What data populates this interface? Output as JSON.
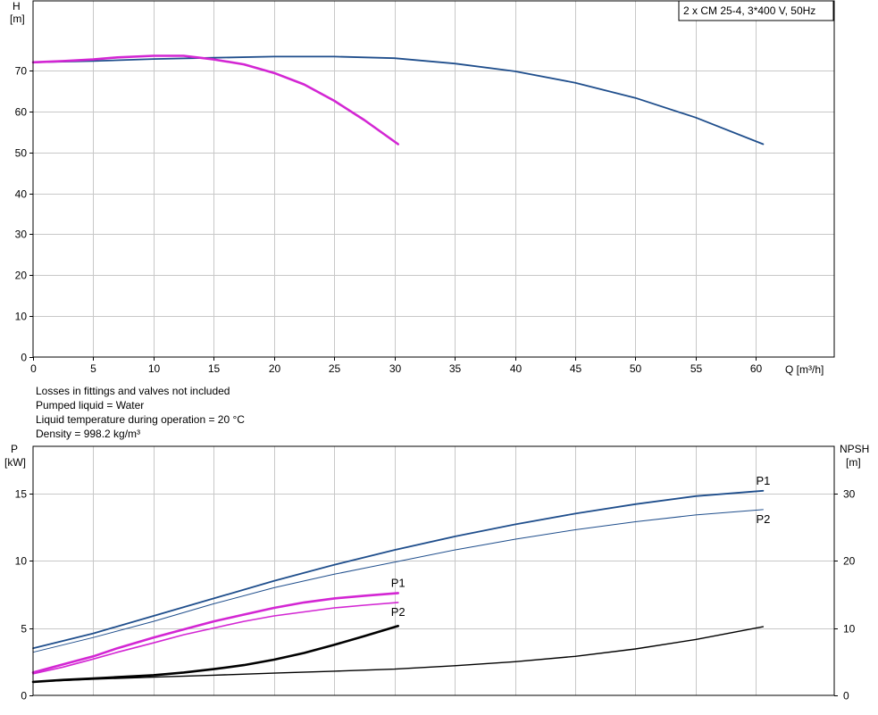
{
  "chart_data": [
    {
      "type": "line",
      "title": "2 x CM 25-4, 3*400 V, 50Hz",
      "ylabel": "H",
      "yunit": "[m]",
      "xlabel": "Q [m³/h]",
      "xlim": [
        0,
        66.5
      ],
      "ylim": [
        0,
        87
      ],
      "xticks": [
        0,
        5,
        10,
        15,
        20,
        25,
        30,
        35,
        40,
        45,
        50,
        55,
        60
      ],
      "yticks": [
        0,
        10,
        20,
        30,
        40,
        50,
        60,
        70
      ],
      "grid": true,
      "series": [
        {
          "color": "#1f4e8c",
          "x": [
            0,
            5,
            10,
            15,
            20,
            25,
            30,
            35,
            40,
            45,
            50,
            55,
            60.6
          ],
          "y": [
            72,
            72.3,
            72.8,
            73.1,
            73.4,
            73.4,
            73.0,
            71.7,
            69.8,
            67.0,
            63.3,
            58.5,
            52.0
          ]
        },
        {
          "color": "#d326d3",
          "x": [
            0,
            2.5,
            5,
            7,
            10,
            12.5,
            15,
            17.5,
            20,
            22.5,
            25,
            27.5,
            30.3
          ],
          "y": [
            72,
            72.3,
            72.7,
            73.2,
            73.6,
            73.6,
            72.7,
            71.5,
            69.4,
            66.6,
            62.6,
            57.9,
            52.0
          ]
        }
      ]
    },
    {
      "type": "line",
      "ylabel": "P",
      "yunit": "[kW]",
      "y2label": "NPSH",
      "y2unit": "[m]",
      "xlim": [
        0,
        66.5
      ],
      "ylim": [
        0,
        18.5
      ],
      "y2lim": [
        0,
        37
      ],
      "xticks": [
        0,
        5,
        10,
        15,
        20,
        25,
        30,
        35,
        40,
        45,
        50,
        55,
        60
      ],
      "yticks": [
        0,
        5,
        10,
        15
      ],
      "y2ticks": [
        0,
        10,
        20,
        30
      ],
      "grid": true,
      "series": [
        {
          "name": "P1",
          "color": "#1f4e8c",
          "x": [
            0,
            5,
            10,
            15,
            20,
            25,
            30,
            35,
            40,
            45,
            50,
            55,
            60.6
          ],
          "y": [
            3.5,
            4.6,
            5.9,
            7.2,
            8.5,
            9.7,
            10.8,
            11.8,
            12.7,
            13.5,
            14.2,
            14.8,
            15.2
          ]
        },
        {
          "name": "P2",
          "color": "#1f4e8c",
          "x": [
            0,
            5,
            10,
            15,
            20,
            25,
            30,
            35,
            40,
            45,
            50,
            55,
            60.6
          ],
          "y": [
            3.2,
            4.3,
            5.5,
            6.8,
            8.0,
            9.0,
            9.9,
            10.8,
            11.6,
            12.3,
            12.9,
            13.4,
            13.8
          ]
        },
        {
          "name": "P1",
          "color": "#d326d3",
          "x": [
            0,
            2.5,
            5,
            7,
            10,
            12.5,
            15,
            17.5,
            20,
            22.5,
            25,
            27.5,
            30.3
          ],
          "y": [
            1.7,
            2.3,
            2.9,
            3.5,
            4.3,
            4.9,
            5.5,
            6.0,
            6.5,
            6.9,
            7.2,
            7.4,
            7.6
          ]
        },
        {
          "name": "P2",
          "color": "#d326d3",
          "x": [
            0,
            2.5,
            5,
            7,
            10,
            12.5,
            15,
            17.5,
            20,
            22.5,
            25,
            27.5,
            30.3
          ],
          "y": [
            1.6,
            2.1,
            2.7,
            3.2,
            3.9,
            4.5,
            5.0,
            5.5,
            5.9,
            6.2,
            6.5,
            6.7,
            6.9
          ]
        },
        {
          "name": "NPSH",
          "axis": "y2",
          "color": "#000000",
          "x": [
            0,
            5,
            10,
            15,
            20,
            25,
            30,
            35,
            40,
            45,
            50,
            55,
            60.6
          ],
          "y": [
            2.0,
            2.4,
            2.7,
            3.0,
            3.3,
            3.6,
            3.9,
            4.4,
            5.0,
            5.8,
            6.9,
            8.3,
            10.2
          ]
        },
        {
          "name": "NPSH",
          "axis": "y2",
          "color": "#000000",
          "x": [
            0,
            2.5,
            5,
            7,
            10,
            12.5,
            15,
            17.5,
            20,
            22.5,
            25,
            27.5,
            30.3
          ],
          "y": [
            2.0,
            2.3,
            2.5,
            2.7,
            3.0,
            3.4,
            3.9,
            4.5,
            5.3,
            6.3,
            7.5,
            8.8,
            10.3
          ]
        }
      ]
    }
  ],
  "notes": [
    "Losses in fittings and valves not included",
    "Pumped liquid = Water",
    "Liquid temperature during operation = 20 °C",
    "Density = 998.2 kg/m³"
  ]
}
